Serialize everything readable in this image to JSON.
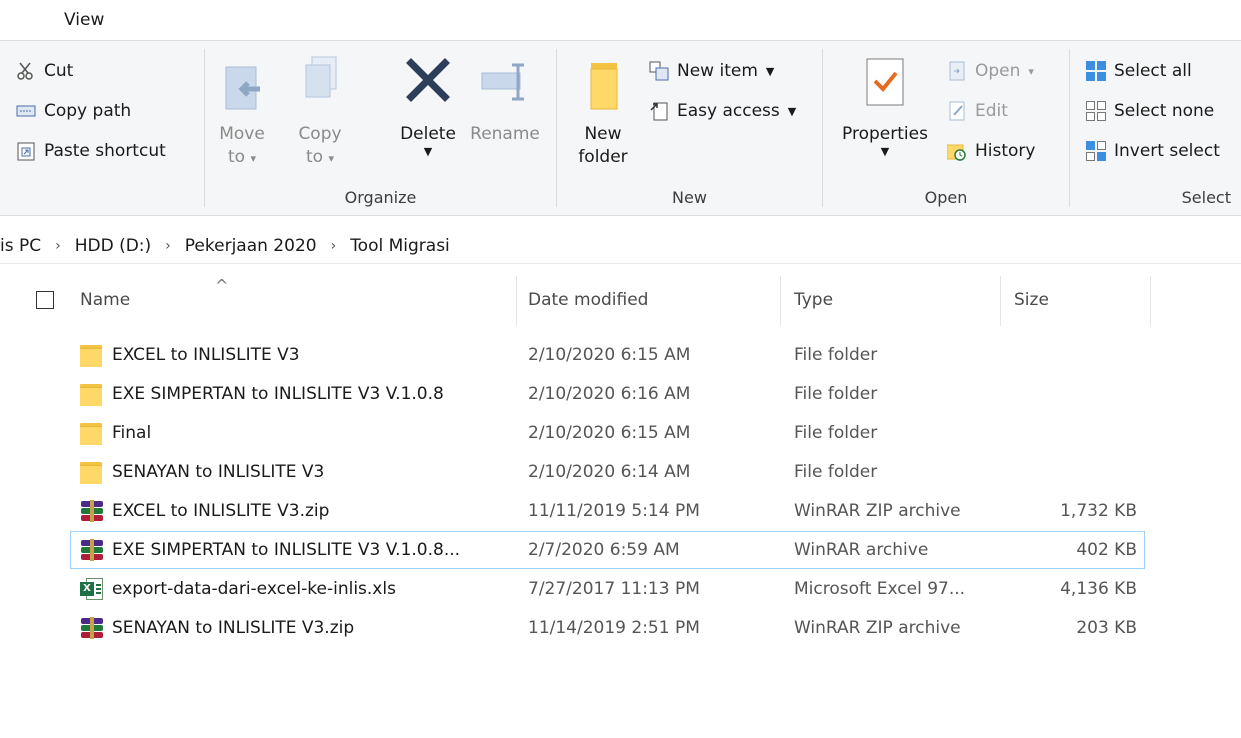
{
  "tabs": {
    "view": "View"
  },
  "ribbon": {
    "clipboard": {
      "cut": "Cut",
      "copy_path": "Copy path",
      "paste_shortcut": "Paste shortcut"
    },
    "organize": {
      "label": "Organize",
      "move_to": "Move",
      "move_to_2": "to",
      "copy_to": "Copy",
      "copy_to_2": "to",
      "delete": "Delete",
      "rename": "Rename"
    },
    "new": {
      "label": "New",
      "new_folder": "New",
      "new_folder_2": "folder",
      "new_item": "New item",
      "easy_access": "Easy access"
    },
    "open": {
      "label": "Open",
      "properties": "Properties",
      "open": "Open",
      "edit": "Edit",
      "history": "History"
    },
    "select": {
      "label": "Select",
      "select_all": "Select all",
      "select_none": "Select none",
      "invert_selection": "Invert select"
    }
  },
  "breadcrumb": [
    "is PC",
    "HDD (D:)",
    "Pekerjaan 2020",
    "Tool Migrasi"
  ],
  "columns": {
    "name": "Name",
    "date": "Date modified",
    "type": "Type",
    "size": "Size"
  },
  "files": [
    {
      "name": "EXCEL to INLISLITE V3",
      "date": "2/10/2020 6:15 AM",
      "type": "File folder",
      "size": "",
      "icon": "folder-icon"
    },
    {
      "name": "EXE SIMPERTAN to INLISLITE V3 V.1.0.8",
      "date": "2/10/2020 6:16 AM",
      "type": "File folder",
      "size": "",
      "icon": "folder-icon"
    },
    {
      "name": "Final",
      "date": "2/10/2020 6:15 AM",
      "type": "File folder",
      "size": "",
      "icon": "folder-icon"
    },
    {
      "name": "SENAYAN to INLISLITE V3",
      "date": "2/10/2020 6:14 AM",
      "type": "File folder",
      "size": "",
      "icon": "folder-icon"
    },
    {
      "name": "EXCEL to INLISLITE V3.zip",
      "date": "11/11/2019 5:14 PM",
      "type": "WinRAR ZIP archive",
      "size": "1,732 KB",
      "icon": "winrar-icon"
    },
    {
      "name": "EXE SIMPERTAN to INLISLITE V3 V.1.0.8...",
      "date": "2/7/2020 6:59 AM",
      "type": "WinRAR archive",
      "size": "402 KB",
      "icon": "winrar-icon"
    },
    {
      "name": "export-data-dari-excel-ke-inlis.xls",
      "date": "7/27/2017 11:13 PM",
      "type": "Microsoft Excel 97...",
      "size": "4,136 KB",
      "icon": "excel-icon"
    },
    {
      "name": "SENAYAN to INLISLITE V3.zip",
      "date": "11/14/2019 2:51 PM",
      "type": "WinRAR ZIP archive",
      "size": "203 KB",
      "icon": "winrar-icon"
    }
  ],
  "selected_row": 5,
  "colors": {
    "selection_border": "#99d1ff",
    "ribbon_bg": "#f5f6f7"
  }
}
